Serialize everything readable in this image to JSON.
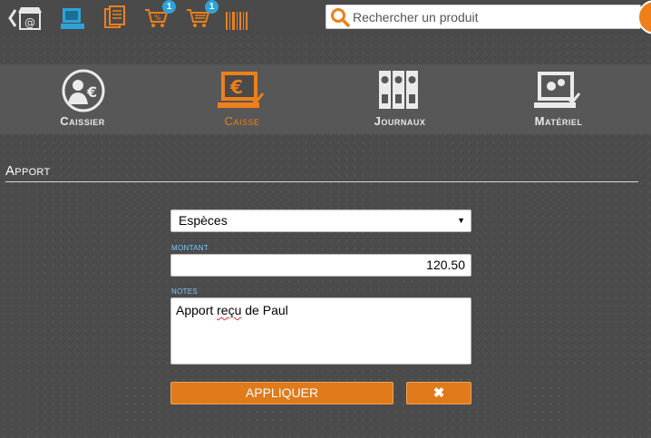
{
  "toolbar": {
    "icons": [
      "back-store-icon",
      "pos-terminal-icon",
      "catalog-icon",
      "discount-cart-icon",
      "cart-icon",
      "barcode-icon"
    ],
    "discount_badge": "1",
    "cart_badge": "1",
    "search_placeholder": "Rechercher un produit"
  },
  "nav": {
    "items": [
      {
        "id": "caissier",
        "label": "Caissier",
        "icon": "cashier-icon",
        "active": false
      },
      {
        "id": "caisse",
        "label": "Caisse",
        "icon": "register-icon",
        "active": true
      },
      {
        "id": "journaux",
        "label": "Journaux",
        "icon": "journals-icon",
        "active": false
      },
      {
        "id": "materiel",
        "label": "Matériel",
        "icon": "hardware-icon",
        "active": false
      }
    ]
  },
  "section": {
    "title": "Apport"
  },
  "form": {
    "payment_method": "Espèces",
    "amount_label": "MONTANT",
    "amount_value": "120.50",
    "notes_label": "NOTES",
    "notes_prefix": "Apport ",
    "notes_misspelled": "reçu",
    "notes_suffix": " de Paul",
    "apply_label": "APPLIQUER",
    "cancel_label": "✖"
  },
  "colors": {
    "accent": "#ee7f1a",
    "badge": "#2fa3d8",
    "field_label": "#7ec8ff",
    "background": "#4b4b4b"
  }
}
